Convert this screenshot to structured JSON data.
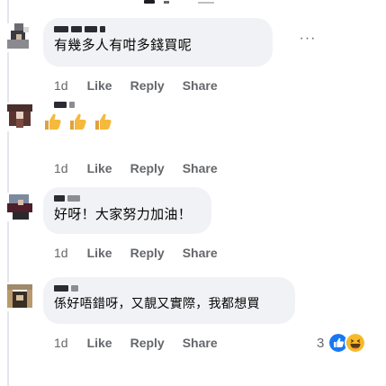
{
  "comments": [
    {
      "text": "有幾多人有咁多錢買呢",
      "time": "1d",
      "like": "Like",
      "reply": "Reply",
      "share": "Share",
      "more_icon": "more-horizontal-icon"
    },
    {
      "emoji": "👍👍👍",
      "time": "1d",
      "like": "Like",
      "reply": "Reply",
      "share": "Share"
    },
    {
      "text": "好呀！大家努力加油！",
      "time": "1d",
      "like": "Like",
      "reply": "Reply",
      "share": "Share"
    },
    {
      "text": "係好唔錯呀，又靚又實際，我都想買",
      "time": "1d",
      "like": "Like",
      "reply": "Reply",
      "share": "Share",
      "reaction_count": "3",
      "reactions": [
        "like-reaction-icon",
        "haha-reaction-icon"
      ]
    }
  ],
  "colors": {
    "bubble": "#f0f2f5",
    "meta_text": "#65676b",
    "like_blue": "#1877f2",
    "haha_yellow": "#f7b928"
  }
}
